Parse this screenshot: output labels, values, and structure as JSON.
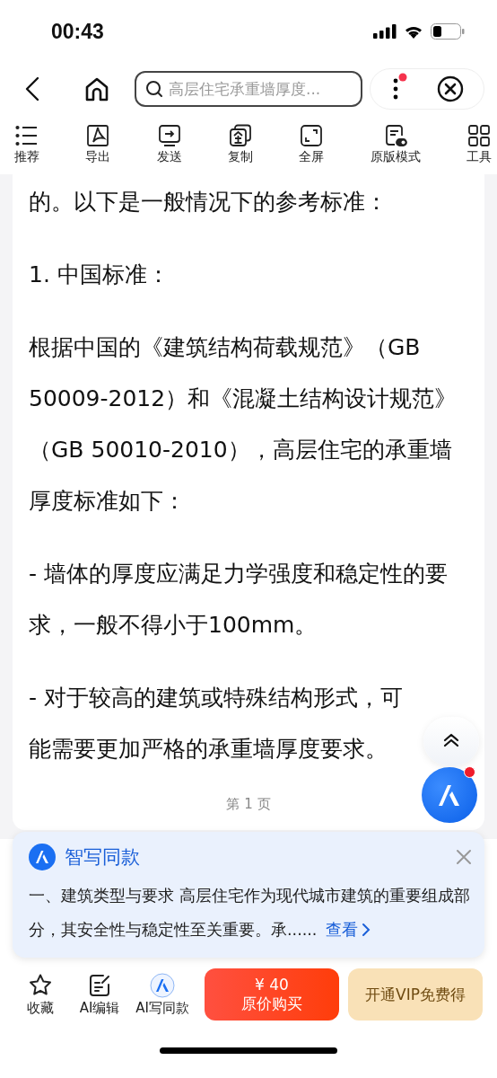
{
  "status_bar": {
    "time": "00:43"
  },
  "nav": {
    "search": {
      "value": "高层住宅承重墙厚度..."
    },
    "has_notification": true
  },
  "toolbar": [
    {
      "label": "推荐"
    },
    {
      "label": "导出"
    },
    {
      "label": "发送"
    },
    {
      "label": "复制"
    },
    {
      "label": "全屏"
    },
    {
      "label": "原版模式"
    },
    {
      "label": "工具"
    }
  ],
  "document": {
    "paragraphs": [
      "的。以下是一般情况下的参考标准：",
      "1. 中国标准：",
      "根据中国的《建筑结构荷载规范》（GB 50009-2012）和《混凝土结构设计规范》（GB 50010-2010），高层住宅的承重墙厚度标准如下：",
      "- 墙体的厚度应满足力学强度和稳定性的要求，一般不得小于100mm。",
      "- 对于较高的建筑或特殊结构形式，可能需要更加严格的承重墙厚度要求。"
    ],
    "page_label": "第 1 页"
  },
  "ai_assistant": {
    "has_notification": true
  },
  "ai_card": {
    "title": "智写同款",
    "text": "一、建筑类型与要求 高层住宅作为现代城市建筑的重要组成部分，其安全性与稳定性至关重要。承......",
    "link": "查看"
  },
  "bottom_bar": {
    "actions": [
      {
        "label": "收藏"
      },
      {
        "label": "AI编辑"
      },
      {
        "label": "AI写同款"
      }
    ],
    "buy": {
      "price": "¥ 40",
      "label": "原价购买"
    },
    "vip": "开通VIP免费得"
  }
}
